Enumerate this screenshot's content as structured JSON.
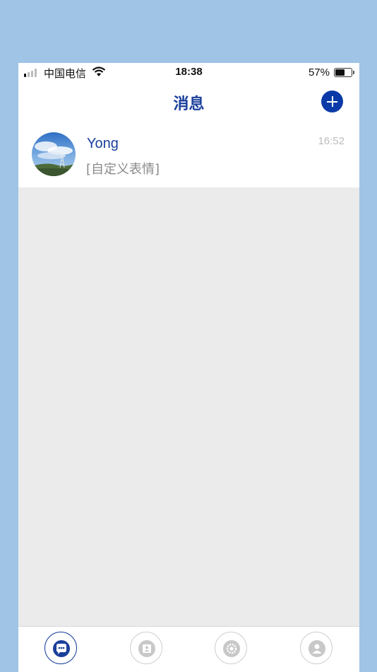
{
  "status_bar": {
    "carrier": "中国电信",
    "time": "18:38",
    "battery_percent": "57%",
    "battery_level": 0.57,
    "signal_bars": 1,
    "icons": [
      "signal-icon",
      "wifi-icon",
      "battery-icon"
    ]
  },
  "header": {
    "title": "消息",
    "add_icon": "plus-icon"
  },
  "messages": [
    {
      "name": "Yong",
      "preview": "[自定义表情]",
      "time": "16:52"
    }
  ],
  "tab_bar": {
    "tabs": [
      {
        "icon": "chat-bubble-icon",
        "active": true
      },
      {
        "icon": "contacts-card-icon",
        "active": false
      },
      {
        "icon": "discover-gear-icon",
        "active": false
      },
      {
        "icon": "profile-person-icon",
        "active": false
      }
    ]
  },
  "colors": {
    "accent": "#1a3f9b",
    "add_button": "#0b3aa8",
    "background_outer": "#9fc4e6",
    "list_background": "#ebebeb"
  }
}
